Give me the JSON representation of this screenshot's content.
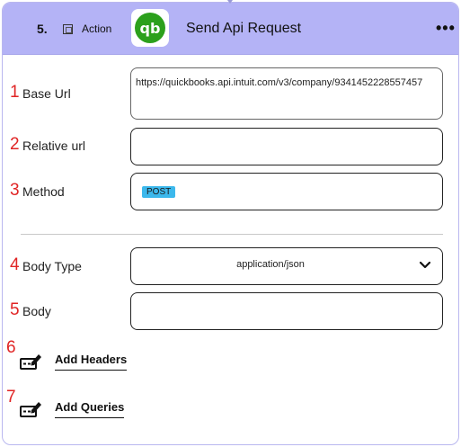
{
  "header": {
    "step_number": "5.",
    "action_label": "Action",
    "title": "Send Api Request",
    "more_label": "•••",
    "app_logo": "qb",
    "header_color": "#b4b3f6",
    "logo_color": "#2ca01c"
  },
  "fields": {
    "base_url": {
      "number": "1",
      "label": "Base Url",
      "value": "https://quickbooks.api.intuit.com/v3/company/9341452228557457"
    },
    "relative_url": {
      "number": "2",
      "label": "Relative url",
      "value": ""
    },
    "method": {
      "number": "3",
      "label": "Method",
      "value": "POST",
      "tag_color": "#3cb8ec"
    },
    "body_type": {
      "number": "4",
      "label": "Body Type",
      "value": "application/json"
    },
    "body": {
      "number": "5",
      "label": "Body",
      "value": ""
    }
  },
  "actions": {
    "add_headers": {
      "number": "6",
      "label": "Add Headers",
      "icon": "edit-list-icon"
    },
    "add_queries": {
      "number": "7",
      "label": "Add Queries",
      "icon": "edit-list-icon"
    }
  },
  "annotation_color": "#e02424"
}
